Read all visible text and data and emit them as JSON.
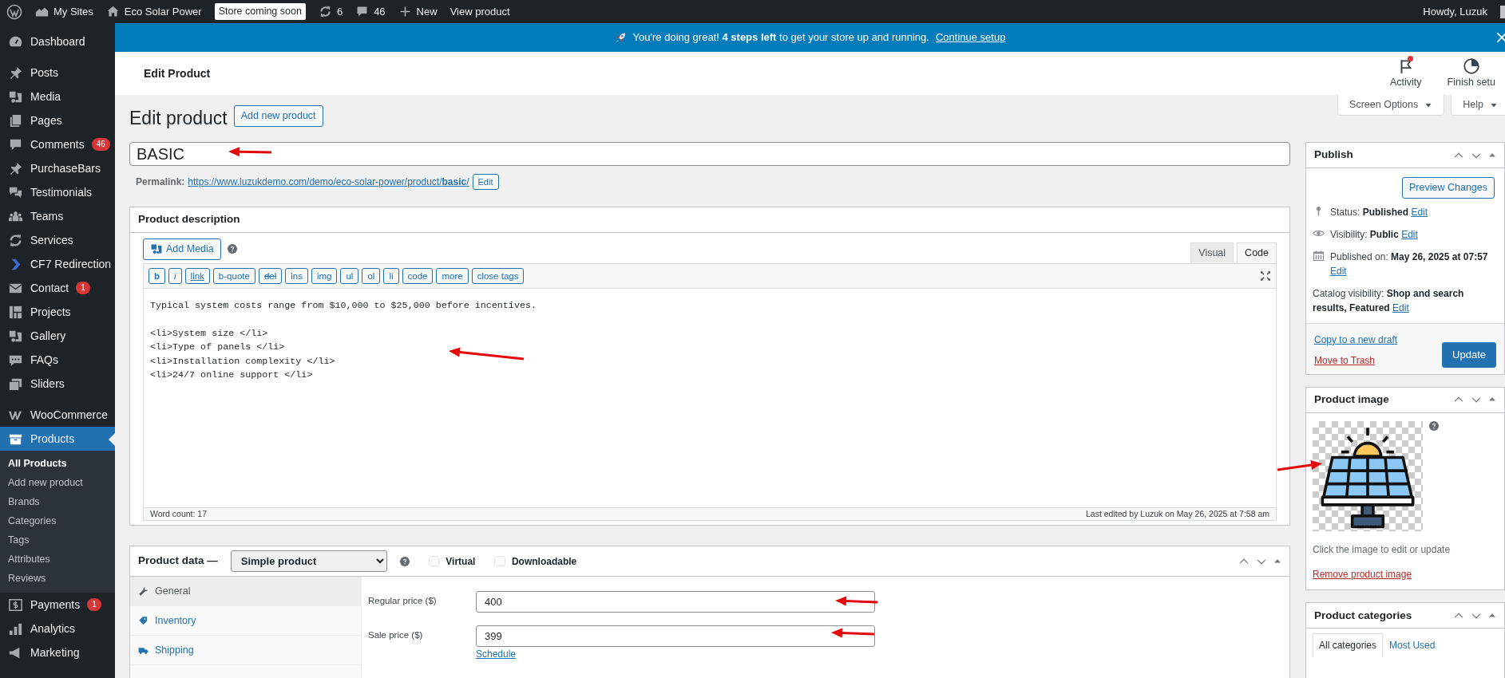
{
  "admin_bar": {
    "items": [
      {
        "kind": "logo"
      },
      {
        "kind": "sites",
        "label": "My Sites"
      },
      {
        "kind": "home",
        "label": "Eco Solar Power"
      },
      {
        "kind": "badge",
        "label": "Store coming soon"
      },
      {
        "kind": "updates",
        "label": "6"
      },
      {
        "kind": "comments",
        "label": "46"
      },
      {
        "kind": "new",
        "label": "New"
      },
      {
        "kind": "plain",
        "label": "View product"
      }
    ],
    "greeting": "Howdy, Luzuk"
  },
  "sidebar": {
    "groups": [
      {
        "items": [
          {
            "kind": "dashboard",
            "label": "Dashboard",
            "selected": false
          }
        ]
      },
      {
        "items": [
          {
            "kind": "pin",
            "label": "Posts",
            "selected": false
          },
          {
            "kind": "media",
            "label": "Media",
            "selected": false
          },
          {
            "kind": "pages",
            "label": "Pages",
            "selected": false
          },
          {
            "kind": "comment",
            "label": "Comments",
            "badge": "46",
            "selected": false
          },
          {
            "kind": "pin",
            "label": "PurchaseBars",
            "selected": false
          },
          {
            "kind": "testimonial",
            "label": "Testimonials",
            "selected": false
          },
          {
            "kind": "teams",
            "label": "Teams",
            "selected": false
          },
          {
            "kind": "sync",
            "label": "Services",
            "selected": false
          },
          {
            "kind": "cf7",
            "label": "CF7 Redirection",
            "selected": false
          },
          {
            "kind": "mail",
            "label": "Contact",
            "badge": "1",
            "selected": false
          },
          {
            "kind": "projects",
            "label": "Projects",
            "selected": false
          },
          {
            "kind": "media",
            "label": "Gallery",
            "selected": false
          },
          {
            "kind": "faq",
            "label": "FAQs",
            "selected": false
          },
          {
            "kind": "sliders",
            "label": "Sliders",
            "selected": false
          }
        ]
      },
      {
        "items": [
          {
            "kind": "woo",
            "label": "WooCommerce",
            "selected": false
          },
          {
            "kind": "products",
            "label": "Products",
            "selected": true,
            "children": [
              {
                "label": "All Products",
                "selected": true
              },
              {
                "label": "Add new product",
                "selected": false
              },
              {
                "label": "Brands",
                "selected": false
              },
              {
                "label": "Categories",
                "selected": false
              },
              {
                "label": "Tags",
                "selected": false
              },
              {
                "label": "Attributes",
                "selected": false
              },
              {
                "label": "Reviews",
                "selected": false
              }
            ]
          },
          {
            "kind": "payments",
            "label": "Payments",
            "badge": "1",
            "selected": false
          },
          {
            "kind": "analytics",
            "label": "Analytics",
            "selected": false
          },
          {
            "kind": "marketing",
            "label": "Marketing",
            "selected": false
          }
        ]
      }
    ]
  },
  "notice": {
    "text": "You're doing great! **4 steps left** to get your store up and running.",
    "link": "Continue setup"
  },
  "header": {
    "title": "Edit Product",
    "actions": [
      {
        "kind": "activity",
        "label": "Activity",
        "alert": true
      },
      {
        "kind": "finish",
        "label": "Finish setu"
      }
    ]
  },
  "screen_tabs": [
    "Screen Options",
    "Help"
  ],
  "page_title": "Edit product",
  "add_new": "Add new product",
  "title_field": {
    "value": "BASIC"
  },
  "permalink": {
    "label": "Permalink:",
    "url": "https://www.luzukdemo.com/demo/eco-solar-power/product/**basic**/",
    "button": "Edit"
  },
  "description": {
    "title": "Product description",
    "add_media": "Add Media",
    "tabs": [
      {
        "label": "Visual",
        "selected": false
      },
      {
        "label": "Code",
        "selected": true
      }
    ],
    "quicktags": [
      {
        "label": "b",
        "kind": "bold"
      },
      {
        "label": "i",
        "kind": "italic"
      },
      {
        "label": "link",
        "kind": "link"
      },
      {
        "label": "b-quote",
        "kind": "plain"
      },
      {
        "label": "del",
        "kind": "strike"
      },
      {
        "label": "ins",
        "kind": "plain"
      },
      {
        "label": "img",
        "kind": "plain"
      },
      {
        "label": "ul",
        "kind": "plain"
      },
      {
        "label": "ol",
        "kind": "plain"
      },
      {
        "label": "li",
        "kind": "plain"
      },
      {
        "label": "code",
        "kind": "plain"
      },
      {
        "label": "more",
        "kind": "plain"
      },
      {
        "label": "close tags",
        "kind": "plain"
      }
    ],
    "content": "Typical system costs range from $10,000 to $25,000 before incentives.\n\n<li>System size </li>\n<li>Type of panels </li>\n<li>Installation complexity </li>\n<li>24/7 online support </li>",
    "word_count": "Word count: 17",
    "last_edited": "Last edited by Luzuk on May 26, 2025 at 7:58 am"
  },
  "product_data": {
    "title": "Product data —",
    "type": "Simple product",
    "options": [
      {
        "label": "Virtual",
        "checked": false
      },
      {
        "label": "Downloadable",
        "checked": false
      }
    ],
    "tabs": [
      {
        "kind": "general",
        "label": "General",
        "selected": true
      },
      {
        "kind": "inventory",
        "label": "Inventory",
        "selected": false
      },
      {
        "kind": "shipping",
        "label": "Shipping",
        "selected": false
      }
    ],
    "fields": [
      {
        "label": "Regular price ($)",
        "value": "400"
      },
      {
        "label": "Sale price ($)",
        "value": "399",
        "link": "Schedule"
      }
    ]
  },
  "publish": {
    "title": "Publish",
    "preview": "Preview Changes",
    "rows": [
      {
        "kind": "status",
        "text": "Status: **Published**",
        "link": "Edit"
      },
      {
        "kind": "visibility",
        "text": "Visibility: **Public**",
        "link": "Edit"
      },
      {
        "kind": "date",
        "text": "Published on: **May 26, 2025 at 07:57**",
        "link": "Edit"
      },
      {
        "kind": "catalog",
        "text": "Catalog visibility: **Shop and search results, Featured**",
        "link": "Edit"
      }
    ],
    "copy": "Copy to a new draft",
    "trash": "Move to Trash",
    "update": "Update"
  },
  "product_image": {
    "title": "Product image",
    "hint": "Click the image to edit or update",
    "remove": "Remove product image"
  },
  "product_categories": {
    "title": "Product categories",
    "tabs": [
      {
        "label": "All categories",
        "selected": true
      },
      {
        "label": "Most Used",
        "selected": false
      }
    ]
  }
}
